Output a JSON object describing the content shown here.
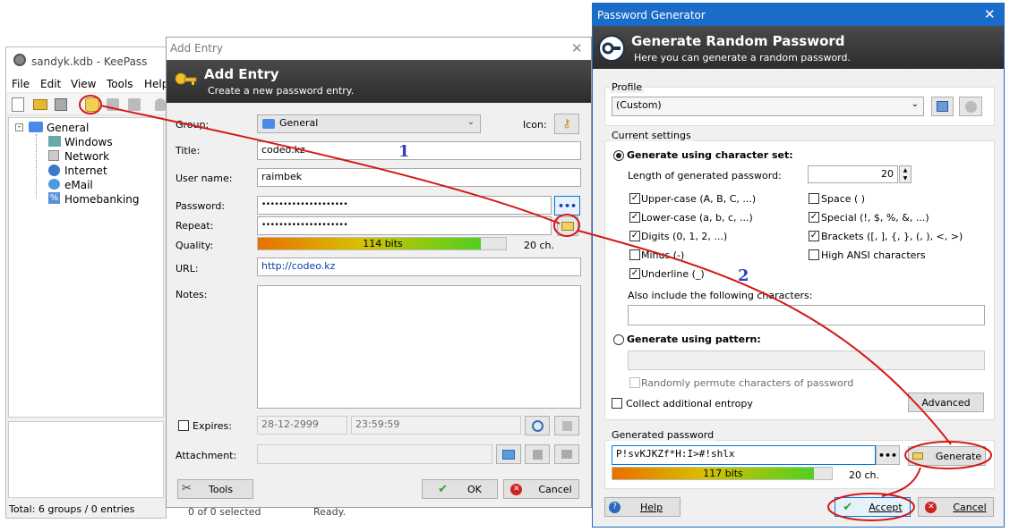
{
  "keepass": {
    "title": "sandyk.kdb - KeePass",
    "menu": [
      "File",
      "Edit",
      "View",
      "Tools",
      "Help"
    ],
    "tree": {
      "root": "General",
      "children": [
        "Windows",
        "Network",
        "Internet",
        "eMail",
        "Homebanking"
      ]
    },
    "status": "Total: 6 groups / 0 entries",
    "status2": "0 of 0 selected",
    "status3": "Ready."
  },
  "add_entry": {
    "window_title": "Add Entry",
    "header_title": "Add Entry",
    "header_subtitle": "Create a new password entry.",
    "group_label": "Group:",
    "group_value": "General",
    "icon_label": "Icon:",
    "title_label": "Title:",
    "title_value": "codeo.kz",
    "username_label": "User name:",
    "username_value": "raimbek",
    "password_label": "Password:",
    "password_value": "••••••••••••••••••••",
    "repeat_label": "Repeat:",
    "repeat_value": "••••••••••••••••••••",
    "quality_label": "Quality:",
    "quality_text": "114 bits",
    "quality_fraction": 0.9,
    "quality_chars": "20 ch.",
    "url_label": "URL:",
    "url_value": "http://codeo.kz",
    "notes_label": "Notes:",
    "expires_label": "Expires:",
    "expires_date": "28-12-2999",
    "expires_time": "23:59:59",
    "attachment_label": "Attachment:",
    "tools_btn": "Tools",
    "ok_btn": "OK",
    "cancel_btn": "Cancel",
    "dots": "•••"
  },
  "pwgen": {
    "window_title": "Password Generator",
    "header_title": "Generate Random Password",
    "header_subtitle": "Here you can generate a random password.",
    "profile_label": "Profile",
    "profile_value": "(Custom)",
    "current_settings": "Current settings",
    "gen_charset": "Generate using character set:",
    "length_label": "Length of generated password:",
    "length_value": "20",
    "charsets": [
      {
        "label": "Upper-case (A, B, C, ...)",
        "checked": true
      },
      {
        "label": "Lower-case (a, b, c, ...)",
        "checked": true
      },
      {
        "label": "Digits (0, 1, 2, ...)",
        "checked": true
      },
      {
        "label": "Minus (-)",
        "checked": false
      },
      {
        "label": "Underline (_)",
        "checked": true
      },
      {
        "label": "Space ( )",
        "checked": false
      },
      {
        "label": "Special (!, $, %, &, ...)",
        "checked": true
      },
      {
        "label": "Brackets ([, ], {, }, (, ), <, >)",
        "checked": true
      },
      {
        "label": "High ANSI characters",
        "checked": false
      }
    ],
    "also_include": "Also include the following characters:",
    "gen_pattern": "Generate using pattern:",
    "permute": "Randomly permute characters of password",
    "entropy": "Collect additional entropy",
    "advanced_btn": "Advanced",
    "generated_label": "Generated password",
    "generated_value": "P!svKJKZf*H:I>#!shlx",
    "quality_text": "117 bits",
    "quality_fraction": 0.92,
    "quality_chars": "20 ch.",
    "generate_btn": "Generate",
    "help_btn": "Help",
    "accept_btn": "Accept",
    "cancel_btn": "Cancel",
    "dots": "•••",
    "close": "✕"
  },
  "annotations": {
    "n1": "1",
    "n2": "2",
    "color": "#d41818"
  }
}
